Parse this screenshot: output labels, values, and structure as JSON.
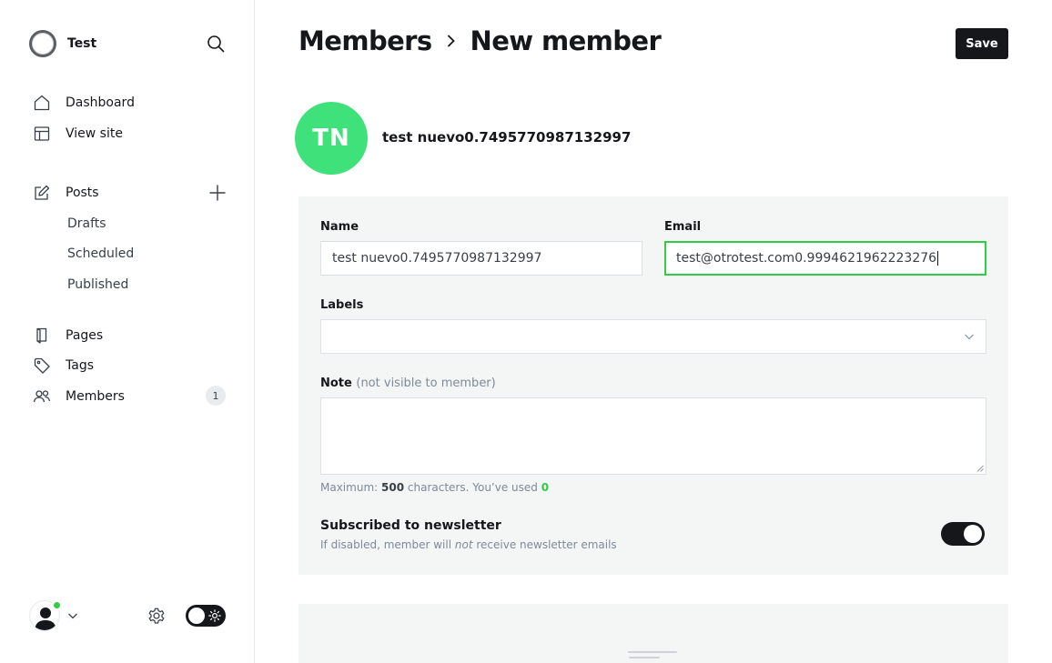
{
  "sidebar": {
    "brand": {
      "name": "Test"
    },
    "nav": [
      {
        "label": "Dashboard",
        "icon": "house-icon"
      },
      {
        "label": "View site",
        "icon": "layout-icon"
      }
    ],
    "posts": {
      "label": "Posts",
      "icon": "pencil-square-icon",
      "sub": [
        "Drafts",
        "Scheduled",
        "Published"
      ]
    },
    "nav2": [
      {
        "label": "Pages",
        "icon": "page-icon"
      },
      {
        "label": "Tags",
        "icon": "tag-icon"
      },
      {
        "label": "Members",
        "icon": "members-icon",
        "badge": "1"
      }
    ]
  },
  "header": {
    "breadcrumb_parent": "Members",
    "breadcrumb_current": "New member",
    "save_label": "Save"
  },
  "member": {
    "initials": "TN",
    "display_name": "test nuevo0.7495770987132997"
  },
  "form": {
    "name_label": "Name",
    "name_value": "test nuevo0.7495770987132997",
    "email_label": "Email",
    "email_value": "test@otrotest.com0.9994621962223276",
    "labels_label": "Labels",
    "note_label": "Note",
    "note_muted": "(not visible to member)",
    "note_value": "",
    "hint_prefix": "Maximum:",
    "hint_max": "500",
    "hint_middle": "characters. You’ve used",
    "hint_used": "0",
    "newsletter_title": "Subscribed to newsletter",
    "newsletter_desc_pre": "If disabled, member will",
    "newsletter_desc_em": "not",
    "newsletter_desc_post": "receive newsletter emails",
    "newsletter_enabled": true
  },
  "colors": {
    "accent": "#30cf43",
    "avatar_bg": "#3ee17a",
    "dark": "#15171a",
    "panel": "#f4f5f5"
  }
}
